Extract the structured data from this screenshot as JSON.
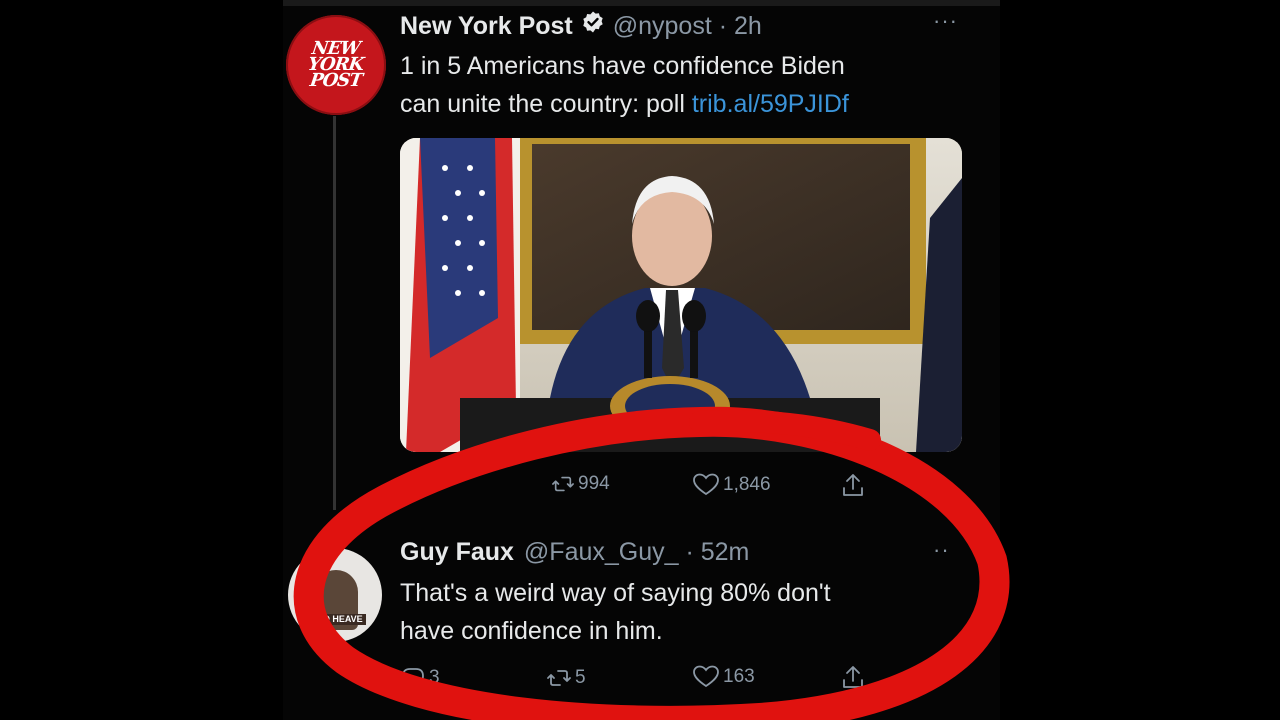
{
  "tweet": {
    "avatar_text": [
      "NEW",
      "YORK",
      "POST"
    ],
    "author_name": "New York Post",
    "handle_time": "@nypost · 2h",
    "more": "···",
    "text_line1": "1 in 5 Americans have confidence Biden",
    "text_line2_prefix": "can unite the country: poll ",
    "link": "trib.al/59PJIDf",
    "retweets": "994",
    "likes": "1,846"
  },
  "reply": {
    "avatar_caption": "IM TO HEAVE",
    "author_name": "Guy Faux",
    "handle_time": "@Faux_Guy_ · 52m",
    "more": "··",
    "text_line1": "That's a weird way of saying 80% don't",
    "text_line2": "have confidence in him.",
    "replies": "3",
    "retweets": "5",
    "likes": "163"
  },
  "colors": {
    "background": "#000000",
    "link": "#3b94d9",
    "muted": "#8b98a5",
    "annotation_red": "#e0120f",
    "nyp_red": "#c4161c"
  },
  "icons": [
    "verified-badge-icon",
    "more-icon",
    "reply-icon",
    "retweet-icon",
    "like-icon",
    "share-icon"
  ]
}
